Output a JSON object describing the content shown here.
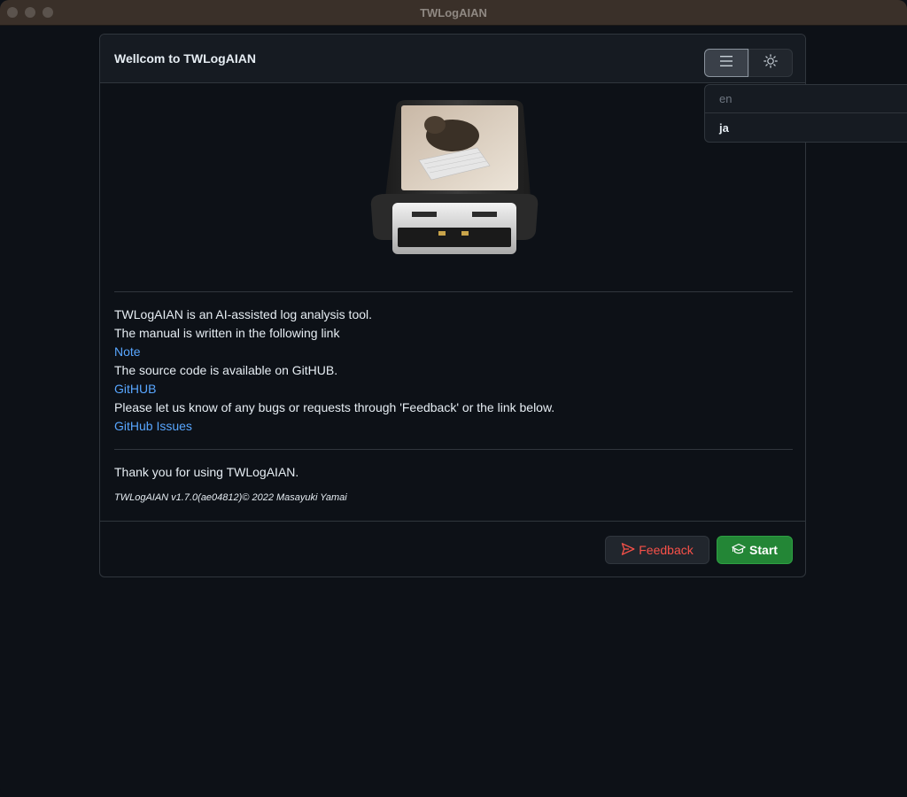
{
  "window": {
    "title": "TWLogAIAN"
  },
  "header": {
    "title": "Wellcom to TWLogAIAN",
    "menu_icon": "hamburger-menu-icon",
    "theme_icon": "sun-icon"
  },
  "language_menu": {
    "options": [
      "en",
      "ja"
    ],
    "selected": "en"
  },
  "body": {
    "line1": "TWLogAIAN is an AI-assisted log analysis tool.",
    "line2": "The manual is written in the following link",
    "manual_link": "Note",
    "line3": "The source code is available on GitHUB.",
    "github_link": "GitHUB",
    "line4": "Please let us know of any bugs or requests through 'Feedback' or the link below.",
    "issues_link": "GitHub Issues",
    "thanks": "Thank you for using TWLogAIAN.",
    "version": "TWLogAIAN v1.7.0(ae04812)© 2022 Masayuki Yamai"
  },
  "footer": {
    "feedback_label": "Feedback",
    "feedback_icon": "paper-plane-icon",
    "start_label": "Start",
    "start_icon": "mortarboard-icon"
  },
  "colors": {
    "background": "#0d1117",
    "link": "#58a6ff",
    "danger": "#f85149",
    "primary": "#238636"
  }
}
